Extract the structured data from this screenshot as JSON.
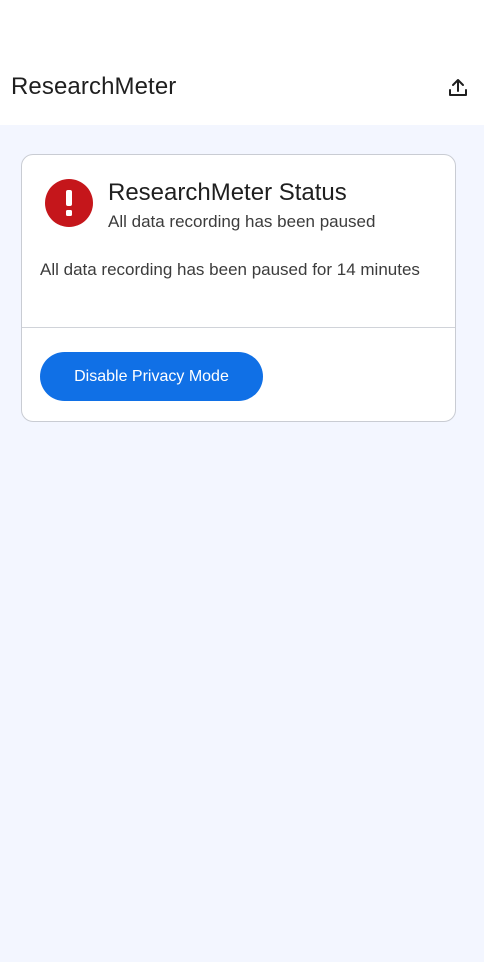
{
  "app_bar": {
    "title": "ResearchMeter",
    "share_icon": "upload-icon"
  },
  "status_card": {
    "icon": "error-icon",
    "icon_color": "#c5161b",
    "title": "ResearchMeter Status",
    "subtitle": "All data recording has been paused",
    "message": "All data recording has been paused for 14 minutes",
    "button_label": "Disable Privacy Mode",
    "button_color": "#1070e6"
  },
  "colors": {
    "page_background": "#f3f6ff",
    "card_background": "#ffffff"
  }
}
